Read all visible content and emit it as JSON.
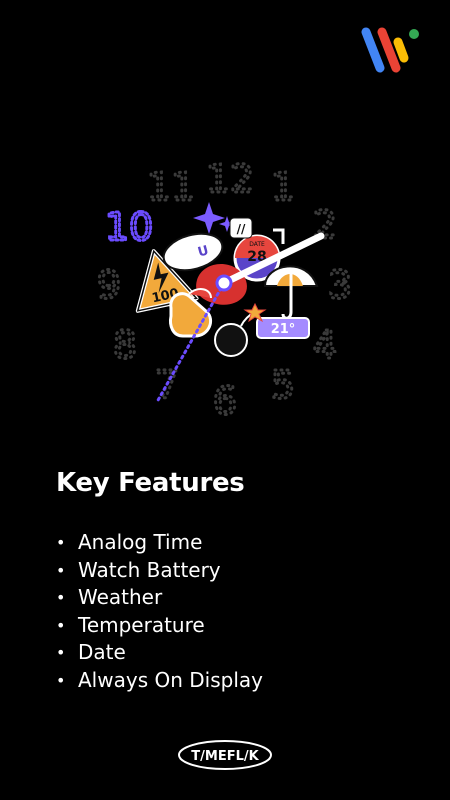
{
  "header": {
    "platform_logo_icon": "wear-os-logo"
  },
  "watch_face": {
    "dial_numerals": [
      "12",
      "1",
      "2",
      "3",
      "4",
      "5",
      "6",
      "7",
      "8",
      "9",
      "10",
      "11"
    ],
    "sticker_texts": {
      "battery": "100",
      "date_label": "DATE",
      "date_value": "28",
      "temperature": "21°",
      "digital": "//",
      "balloon": "U"
    },
    "colors": {
      "accent_purple": "#7b5cff",
      "dial_digits": "#3a3a3a",
      "active_hour": "#6b4cff"
    }
  },
  "features": {
    "title": "Key Features",
    "items": [
      "Analog Time",
      "Watch Battery",
      "Weather",
      "Temperature",
      "Date",
      "Always On Display"
    ],
    "bullet": "•"
  },
  "footer": {
    "brand": "T/MEFL/K"
  }
}
